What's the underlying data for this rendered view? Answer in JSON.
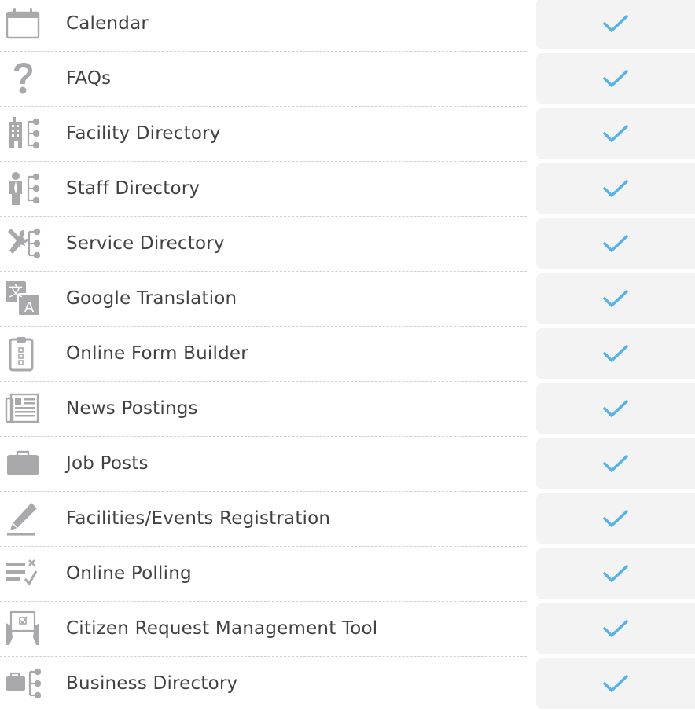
{
  "colors": {
    "check": "#57b2e6",
    "icon": "#a9a9ab",
    "label": "#414141",
    "cell": "#f3f3f3",
    "separator": "#cfcfcf"
  },
  "features": [
    {
      "label": "Calendar",
      "icon": "calendar-icon",
      "included": true
    },
    {
      "label": "FAQs",
      "icon": "question-icon",
      "included": true
    },
    {
      "label": "Facility Directory",
      "icon": "building-directory-icon",
      "included": true
    },
    {
      "label": "Staff Directory",
      "icon": "person-directory-icon",
      "included": true
    },
    {
      "label": "Service Directory",
      "icon": "tools-directory-icon",
      "included": true
    },
    {
      "label": "Google Translation",
      "icon": "translate-icon",
      "included": true
    },
    {
      "label": "Online Form Builder",
      "icon": "clipboard-form-icon",
      "included": true
    },
    {
      "label": "News Postings",
      "icon": "newspaper-icon",
      "included": true
    },
    {
      "label": "Job Posts",
      "icon": "briefcase-icon",
      "included": true
    },
    {
      "label": "Facilities/Events Registration",
      "icon": "pencil-icon",
      "included": true
    },
    {
      "label": "Online Polling",
      "icon": "poll-checklist-icon",
      "included": true
    },
    {
      "label": "Citizen Request Management Tool",
      "icon": "request-board-icon",
      "included": true
    },
    {
      "label": "Business Directory",
      "icon": "briefcase-directory-icon",
      "included": true
    }
  ]
}
